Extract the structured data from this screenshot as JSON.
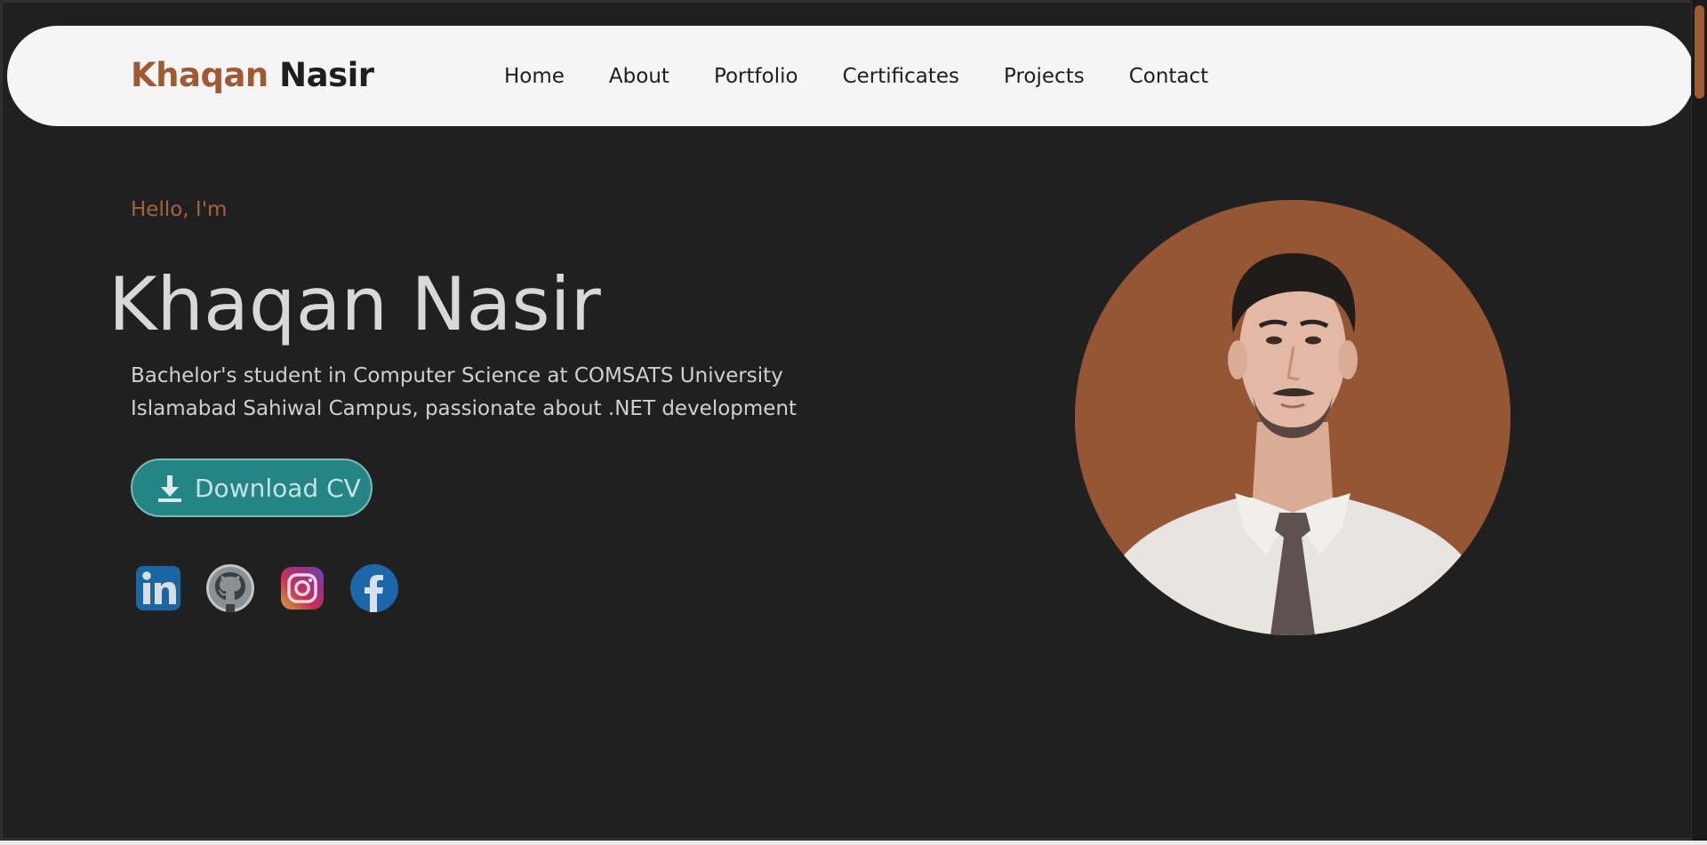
{
  "brand": {
    "first": "Khaqan",
    "last": "Nasir"
  },
  "nav": {
    "items": [
      "Home",
      "About",
      "Portfolio",
      "Certificates",
      "Projects",
      "Contact"
    ]
  },
  "hero": {
    "greeting": "Hello, I'm",
    "name": "Khaqan Nasir",
    "tagline": "Bachelor's student in Computer Science at COMSATS University Islamabad Sahiwal Campus, passionate about .NET development",
    "cv_button_label": "Download CV"
  },
  "socials": [
    {
      "name": "LinkedIn",
      "icon": "linkedin-icon"
    },
    {
      "name": "GitHub",
      "icon": "github-icon"
    },
    {
      "name": "Instagram",
      "icon": "instagram-icon"
    },
    {
      "name": "Facebook",
      "icon": "facebook-icon"
    }
  ],
  "colors": {
    "background": "#212021",
    "accent": "#a05a33",
    "navbar": "#f5f5f5",
    "button": "#258585",
    "portrait_bg": "#945634"
  }
}
